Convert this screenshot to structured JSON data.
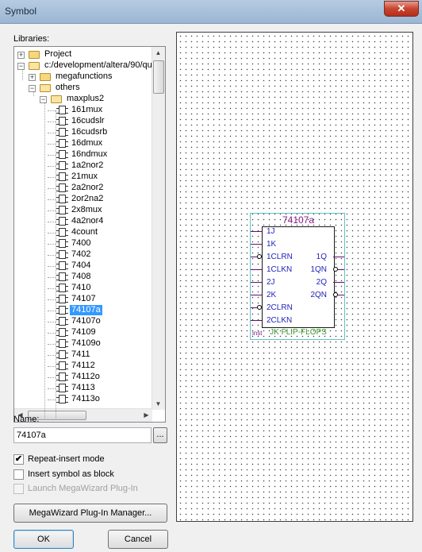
{
  "window": {
    "title": "Symbol",
    "close_glyph": "✕"
  },
  "libraries_label": "Libraries:",
  "tree": [
    {
      "label": "Project",
      "level": 0,
      "expander": "+",
      "icon": "folder"
    },
    {
      "label": "c:/development/altera/90/qu",
      "level": 0,
      "expander": "−",
      "icon": "folder-open"
    },
    {
      "label": "megafunctions",
      "level": 1,
      "expander": "+",
      "icon": "folder"
    },
    {
      "label": "others",
      "level": 1,
      "expander": "−",
      "icon": "folder-open"
    },
    {
      "label": "maxplus2",
      "level": 2,
      "expander": "−",
      "icon": "folder-open"
    },
    {
      "label": "161mux",
      "level": 3,
      "icon": "chip"
    },
    {
      "label": "16cudslr",
      "level": 3,
      "icon": "chip"
    },
    {
      "label": "16cudsrb",
      "level": 3,
      "icon": "chip"
    },
    {
      "label": "16dmux",
      "level": 3,
      "icon": "chip"
    },
    {
      "label": "16ndmux",
      "level": 3,
      "icon": "chip"
    },
    {
      "label": "1a2nor2",
      "level": 3,
      "icon": "chip"
    },
    {
      "label": "21mux",
      "level": 3,
      "icon": "chip"
    },
    {
      "label": "2a2nor2",
      "level": 3,
      "icon": "chip"
    },
    {
      "label": "2or2na2",
      "level": 3,
      "icon": "chip"
    },
    {
      "label": "2x8mux",
      "level": 3,
      "icon": "chip"
    },
    {
      "label": "4a2nor4",
      "level": 3,
      "icon": "chip"
    },
    {
      "label": "4count",
      "level": 3,
      "icon": "chip"
    },
    {
      "label": "7400",
      "level": 3,
      "icon": "chip"
    },
    {
      "label": "7402",
      "level": 3,
      "icon": "chip"
    },
    {
      "label": "7404",
      "level": 3,
      "icon": "chip"
    },
    {
      "label": "7408",
      "level": 3,
      "icon": "chip"
    },
    {
      "label": "7410",
      "level": 3,
      "icon": "chip"
    },
    {
      "label": "74107",
      "level": 3,
      "icon": "chip"
    },
    {
      "label": "74107a",
      "level": 3,
      "icon": "chip",
      "selected": true
    },
    {
      "label": "74107o",
      "level": 3,
      "icon": "chip"
    },
    {
      "label": "74109",
      "level": 3,
      "icon": "chip"
    },
    {
      "label": "74109o",
      "level": 3,
      "icon": "chip"
    },
    {
      "label": "7411",
      "level": 3,
      "icon": "chip"
    },
    {
      "label": "74112",
      "level": 3,
      "icon": "chip"
    },
    {
      "label": "74112o",
      "level": 3,
      "icon": "chip"
    },
    {
      "label": "74113",
      "level": 3,
      "icon": "chip"
    },
    {
      "label": "74113o",
      "level": 3,
      "icon": "chip"
    }
  ],
  "scroll_glyphs": {
    "up": "▲",
    "down": "▼",
    "left": "◀",
    "right": "▶"
  },
  "name": {
    "label": "Name:",
    "value": "74107a",
    "browse": "..."
  },
  "options": {
    "repeat_insert": {
      "label": "Repeat-insert mode",
      "checked": true,
      "mark": "✔"
    },
    "insert_as_block": {
      "label": "Insert symbol as block",
      "checked": false
    },
    "launch_megawizard": {
      "label": "Launch MegaWizard Plug-In",
      "checked": false,
      "disabled": true
    }
  },
  "buttons": {
    "megawizard": "MegaWizard Plug-In Manager...",
    "ok": "OK",
    "cancel": "Cancel"
  },
  "symbol": {
    "title": "74107a",
    "inst": "inst",
    "footer": "JK FLIP-FLOPS",
    "inputs": [
      {
        "name": "1J",
        "inverted": false
      },
      {
        "name": "1K",
        "inverted": false
      },
      {
        "name": "1CLRN",
        "inverted": true
      },
      {
        "name": "1CLKN",
        "inverted": false
      },
      {
        "name": "2J",
        "inverted": false
      },
      {
        "name": "2K",
        "inverted": false
      },
      {
        "name": "2CLRN",
        "inverted": true
      },
      {
        "name": "2CLKN",
        "inverted": false
      }
    ],
    "outputs": [
      {
        "name": "1Q",
        "inverted": false,
        "row": 2
      },
      {
        "name": "1QN",
        "inverted": true,
        "row": 3
      },
      {
        "name": "2Q",
        "inverted": false,
        "row": 4
      },
      {
        "name": "2QN",
        "inverted": true,
        "row": 5
      }
    ]
  },
  "colors": {
    "selection": "#3399ff",
    "symbol_title": "#8b1b8b",
    "pin_label": "#1f1fb8",
    "footer": "#3a9a2a"
  }
}
